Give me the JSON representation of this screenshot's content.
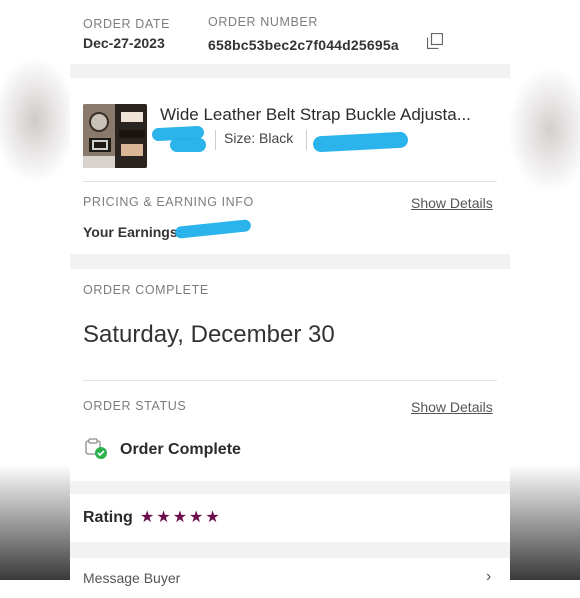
{
  "order": {
    "date_label": "ORDER DATE",
    "date_value": "Dec-27-2023",
    "number_label": "ORDER NUMBER",
    "number_value": "658bc53bec2c7f044d25695a"
  },
  "item": {
    "title": "Wide Leather Belt Strap Buckle Adjusta...",
    "size_text": "Size: Black"
  },
  "pricing": {
    "label": "PRICING & EARNING INFO",
    "show_details": "Show Details",
    "earnings_label": "Your Earnings:"
  },
  "complete": {
    "label": "ORDER COMPLETE",
    "date": "Saturday, December 30"
  },
  "status": {
    "label": "ORDER STATUS",
    "show_details": "Show Details",
    "value": "Order Complete"
  },
  "rating": {
    "label": "Rating",
    "stars": 5,
    "star_color": "#6b0f4c"
  },
  "message": {
    "label": "Message Buyer"
  },
  "colors": {
    "redaction": "#1fb0ea",
    "check_green": "#2bb24c"
  }
}
